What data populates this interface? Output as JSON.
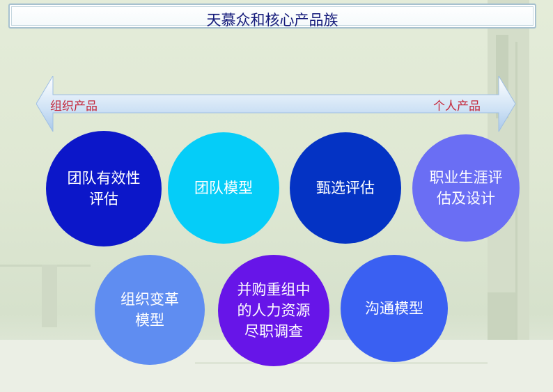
{
  "title": "天慕众和核心产品族",
  "axis": {
    "left_label": "组织产品",
    "right_label": "个人产品",
    "arrow_color": "#bcd7f1"
  },
  "products": [
    {
      "label": "团队有效性\n评估",
      "color": "#0c17c9"
    },
    {
      "label": "团队模型",
      "color": "#05cdf8"
    },
    {
      "label": "甄选评估",
      "color": "#0433c4"
    },
    {
      "label": "职业生涯评\n估及设计",
      "color": "#6a6ef4"
    },
    {
      "label": "组织变革\n模型",
      "color": "#5f8df1"
    },
    {
      "label": "并购重组中\n的人力资源\n尽职调查",
      "color": "#6715e8"
    },
    {
      "label": "沟通模型",
      "color": "#3a60f2"
    }
  ]
}
